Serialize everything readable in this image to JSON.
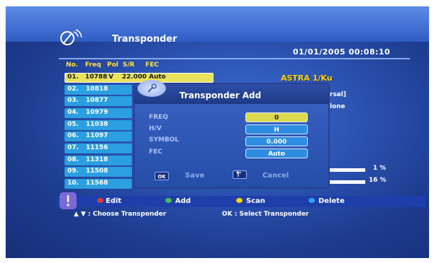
{
  "header": {
    "title": "Transponder",
    "datetime": "01/01/2005 00:08:10",
    "satellite": "ASTRA 1/Ku"
  },
  "columns": {
    "no": "No.",
    "freq": "Freq",
    "pol": "Pol",
    "sr": "S/R",
    "fec": "FEC"
  },
  "transponders": [
    {
      "no": "01.",
      "freq": "10788",
      "pol": "V",
      "sr": "22.000",
      "fec": "Auto"
    },
    {
      "no": "02.",
      "freq": "10818"
    },
    {
      "no": "03.",
      "freq": "10877"
    },
    {
      "no": "04.",
      "freq": "10979"
    },
    {
      "no": "05.",
      "freq": "11038"
    },
    {
      "no": "06.",
      "freq": "11097"
    },
    {
      "no": "07.",
      "freq": "11156"
    },
    {
      "no": "08.",
      "freq": "11318"
    },
    {
      "no": "09.",
      "freq": "11508"
    },
    {
      "no": "10.",
      "freq": "11568"
    }
  ],
  "info_peek": [
    "rsal]",
    "lone"
  ],
  "dialog": {
    "title": "Transponder Add",
    "fields": [
      {
        "label": "FREQ",
        "value": "0"
      },
      {
        "label": "H/V",
        "value": "H"
      },
      {
        "label": "SYMBOL",
        "value": "0.000"
      },
      {
        "label": "FEC",
        "value": "Auto"
      }
    ],
    "ok_key": "OK",
    "save_label": "Save",
    "cancel_label": "Cancel"
  },
  "signal": {
    "strength_label": "1 %",
    "strength": 0.01,
    "quality_label": "16 %",
    "quality": 0.16
  },
  "legend": {
    "edit": "Edit",
    "add": "Add",
    "scan": "Scan",
    "delete": "Delete",
    "colors": {
      "edit": "#e23a3a",
      "add": "#3ec64a",
      "scan": "#ffd400",
      "delete": "#2fa0ff"
    }
  },
  "hints": {
    "choose": "▲ ▼ : Choose Transponder",
    "select": "OK : Select Transponder"
  }
}
